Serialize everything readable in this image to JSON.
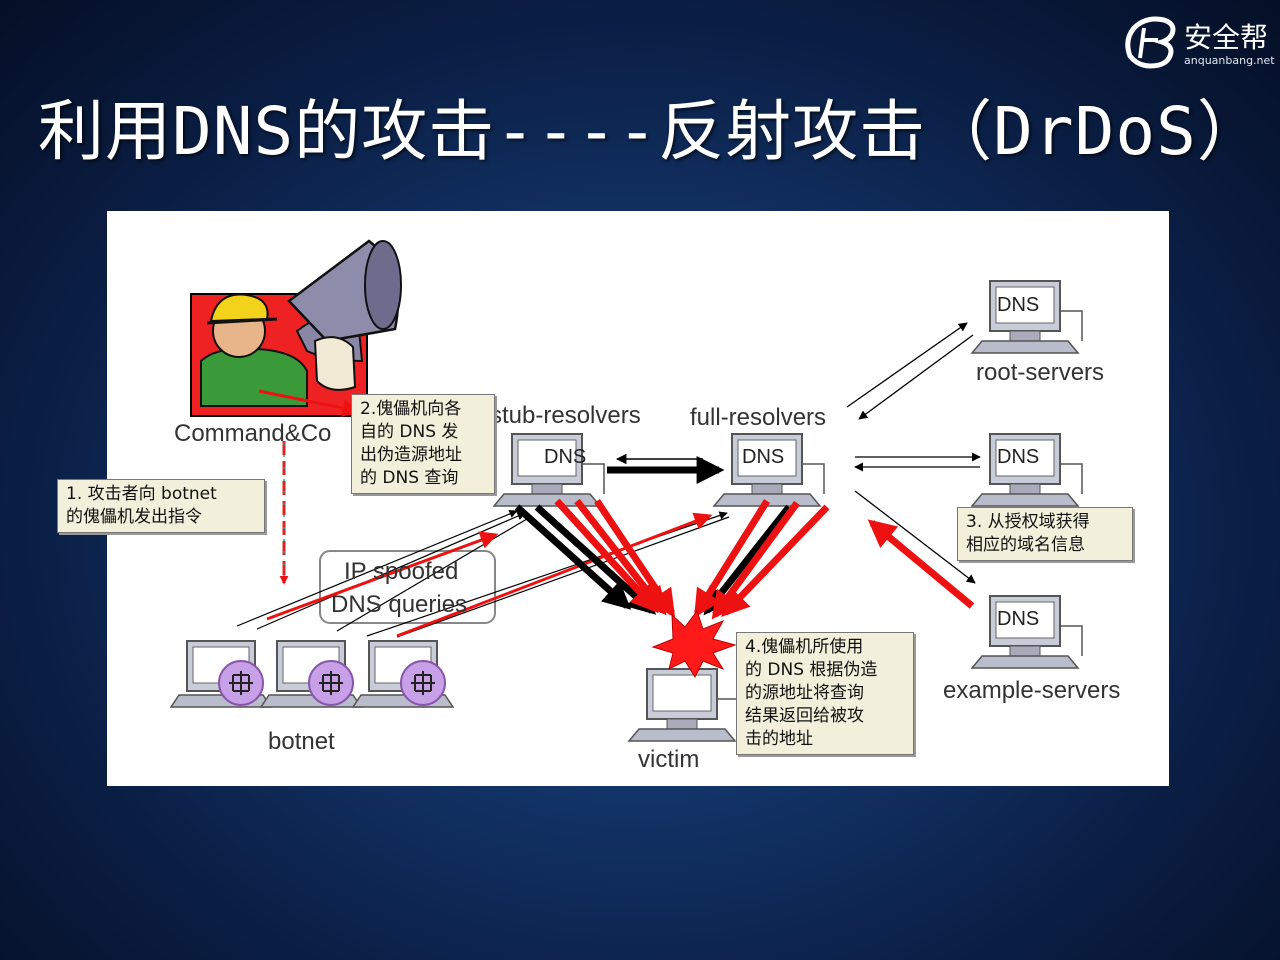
{
  "title": "利用DNS的攻击----反射攻击（DrDoS）",
  "logo": {
    "name": "安全帮",
    "url": "anquanbang.net"
  },
  "diagram": {
    "labels": {
      "command": "Command&Co",
      "stub_resolvers": "stub-resolvers",
      "full_resolvers": "full-resolvers",
      "root_servers": "root-servers",
      "example_servers": "example-servers",
      "botnet": "botnet",
      "victim": "victim",
      "ip_spoofed_line1": "IP spoofed",
      "ip_spoofed_line2": "DNS queries",
      "dns": "DNS"
    },
    "notes": {
      "note1": [
        "1. 攻击者向 botnet",
        "的傀儡机发出指令"
      ],
      "note2": [
        "2.傀儡机向各",
        "自的 DNS 发",
        "出伪造源地址",
        "的 DNS 查询"
      ],
      "note3": [
        "3. 从授权域获得",
        "相应的域名信息"
      ],
      "note4": [
        "4.傀儡机所使用",
        "的 DNS 根据伪造",
        "的源地址将查询",
        "结果返回给被攻",
        "击的地址"
      ]
    },
    "colors": {
      "attack": "#ee1111",
      "response": "#000000",
      "monitor": "#c8ccd8",
      "screen": "#ffffff",
      "burst": "#ff1a1a",
      "bot": "#c8a0e8"
    }
  }
}
